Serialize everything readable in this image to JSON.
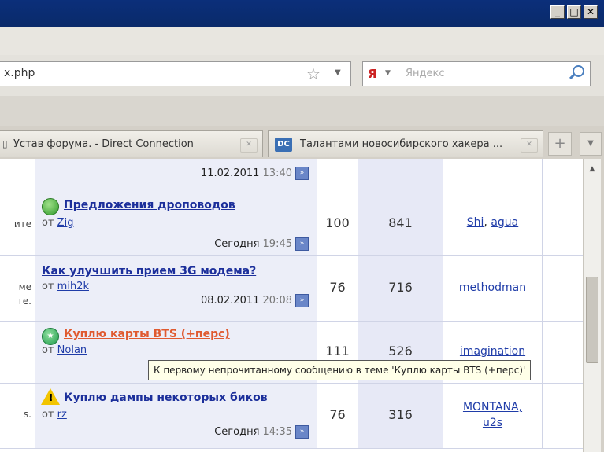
{
  "window": {
    "minimize": "_",
    "maximize": "□",
    "close": "✕"
  },
  "address": {
    "url": "x.php"
  },
  "search": {
    "placeholder": "Яндекс",
    "engine_glyph": "Я"
  },
  "tabs": [
    {
      "label": "Устав форума. - Direct Connection"
    },
    {
      "label": "Талантами новосибирского хакера ...",
      "favicon": "DC"
    }
  ],
  "newtab_label": "+",
  "rows": [
    {
      "desc": [],
      "title": "",
      "by_label": "от",
      "author": "",
      "last_date": "11.02.2011",
      "last_time": "13:40",
      "replies": "",
      "views": "",
      "mods": []
    },
    {
      "desc": [
        "ите"
      ],
      "icon": "green-circle-icon",
      "title": "Предложения дроповодов",
      "by_label": "от",
      "author": "Zig",
      "last_date": "Сегодня",
      "last_time": "19:45",
      "replies": "100",
      "views": "841",
      "mods": [
        "Shi",
        "agua"
      ]
    },
    {
      "desc": [
        "ме",
        "те."
      ],
      "icon": "",
      "title": "Как улучшить прием 3G модема?",
      "by_label": "от",
      "author": "mih2k",
      "last_date": "08.02.2011",
      "last_time": "20:08",
      "replies": "76",
      "views": "716",
      "mods": [
        "methodman"
      ]
    },
    {
      "desc": [],
      "icon": "green-star-icon",
      "title": "Куплю карты BTS (+перс)",
      "by_label": "от",
      "author": "Nolan",
      "last_date": "",
      "last_time": "",
      "replies": "111",
      "views": "526",
      "mods": [
        "imagination"
      ]
    },
    {
      "desc": [
        "s."
      ],
      "icon": "warning-icon",
      "title": "Куплю дампы некоторых биков",
      "by_label": "от",
      "author": "rz",
      "last_date": "Сегодня",
      "last_time": "14:35",
      "replies": "76",
      "views": "316",
      "mods": [
        "MONTANA,",
        "u2s"
      ]
    }
  ],
  "tooltip": "К первому непрочитанному сообщению в теме 'Куплю карты BTS (+перс)'",
  "colors": {
    "link": "#1c2f9b",
    "hover_link": "#e05a30",
    "titlebar": "#0b2f7a"
  }
}
